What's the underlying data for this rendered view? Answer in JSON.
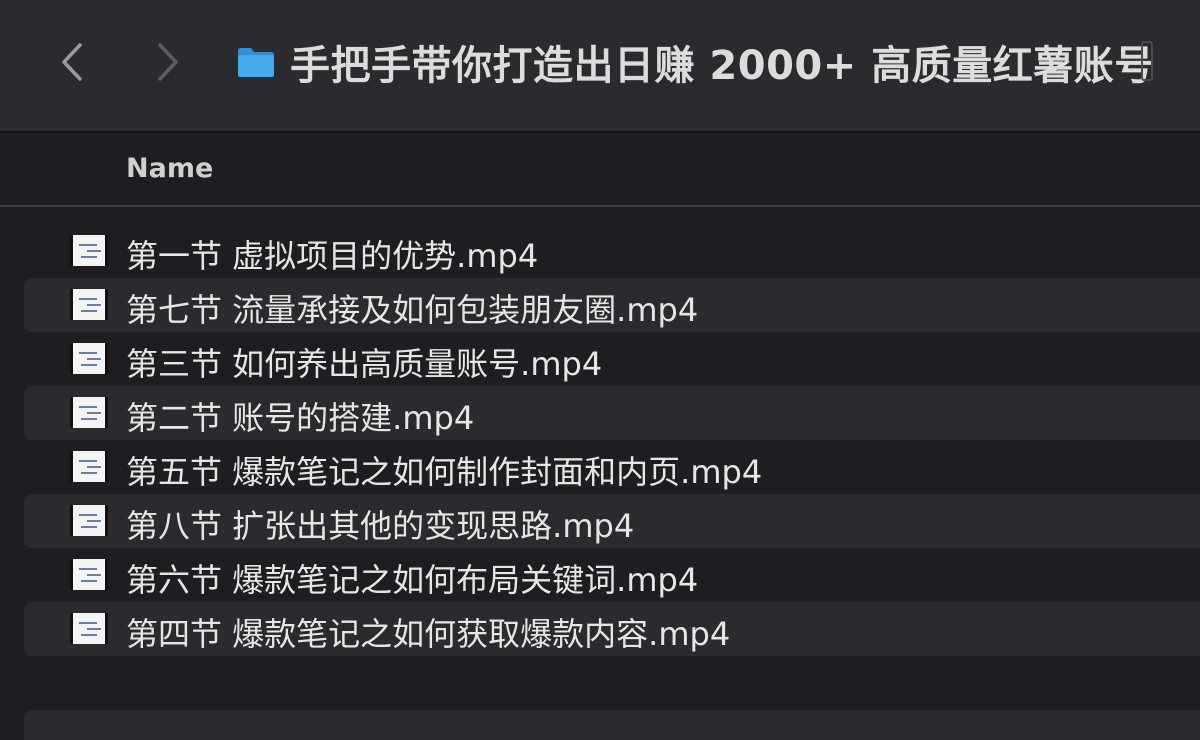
{
  "window": {
    "title": "手把手带你打造出日赚 2000+ 高质量红薯账号",
    "folder_icon": "folder-icon",
    "folder_color": "#3aa0e8",
    "back_icon": "chevron-left-icon",
    "forward_icon": "chevron-right-icon"
  },
  "columns": {
    "name": "Name"
  },
  "files": [
    {
      "name": "第一节 虚拟项目的优势.mp4",
      "icon": "video-thumbnail-icon"
    },
    {
      "name": "第七节 流量承接及如何包装朋友圈.mp4",
      "icon": "video-thumbnail-icon"
    },
    {
      "name": "第三节 如何养出高质量账号.mp4",
      "icon": "video-thumbnail-icon"
    },
    {
      "name": "第二节 账号的搭建.mp4",
      "icon": "video-thumbnail-icon"
    },
    {
      "name": "第五节 爆款笔记之如何制作封面和内页.mp4",
      "icon": "video-thumbnail-icon"
    },
    {
      "name": "第八节 扩张出其他的变现思路.mp4",
      "icon": "video-thumbnail-icon"
    },
    {
      "name": "第六节 爆款笔记之如何布局关键词.mp4",
      "icon": "video-thumbnail-icon"
    },
    {
      "name": "第四节 爆款笔记之如何获取爆款内容.mp4",
      "icon": "video-thumbnail-icon"
    }
  ],
  "colors": {
    "background": "#1e1e22",
    "toolbar": "#2b2a2f",
    "alt_row": "#2a2a2f",
    "text": "#e6e6e6"
  }
}
